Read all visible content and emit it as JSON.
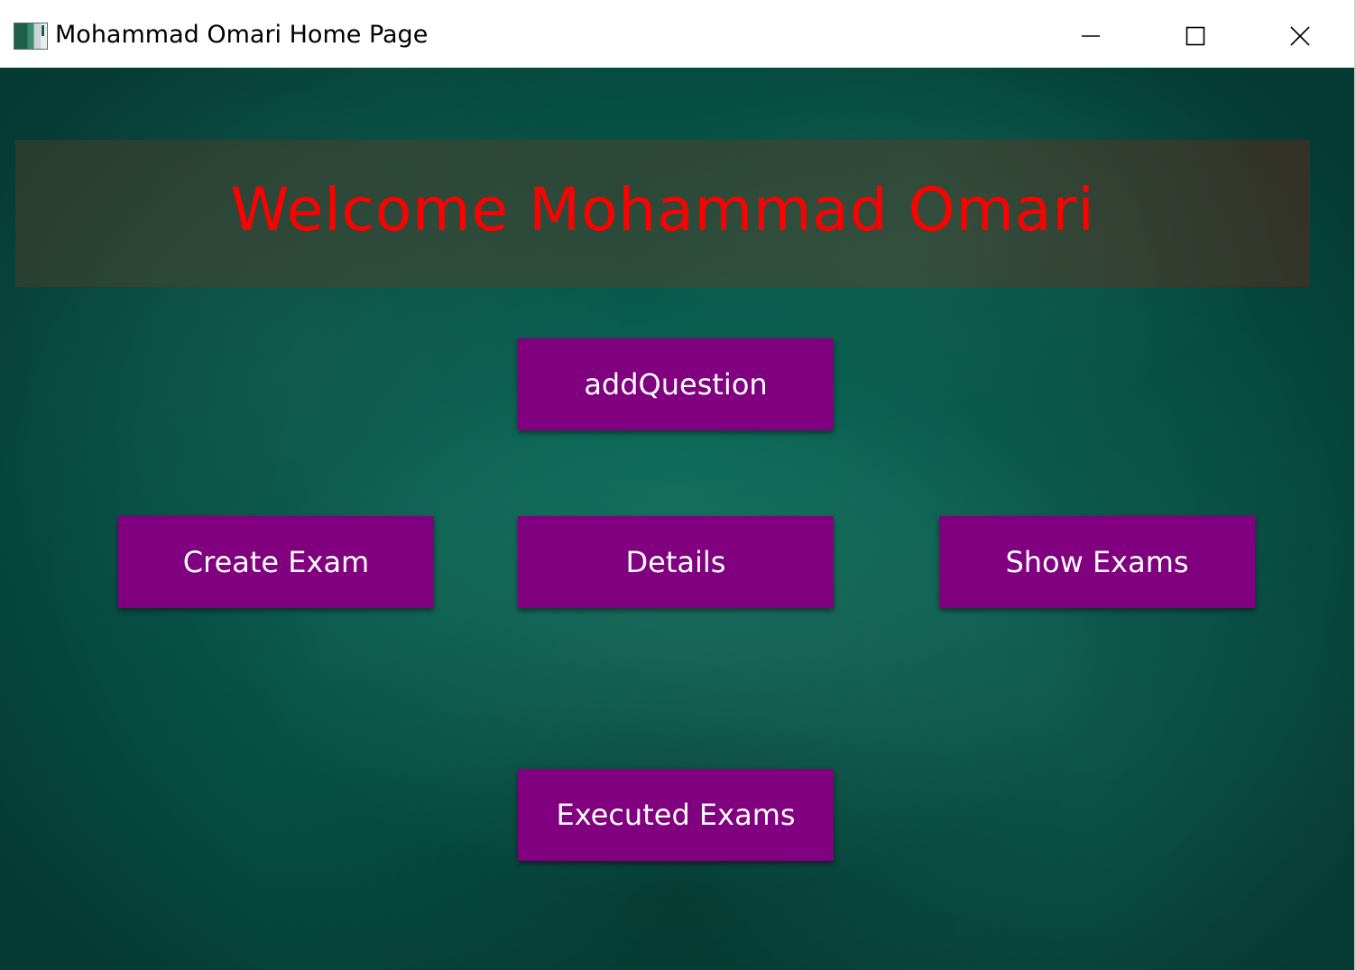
{
  "window": {
    "title": "Mohammad Omari Home Page",
    "icon": "app-window-icon",
    "controls": {
      "minimize_icon": "minimize-icon",
      "maximize_icon": "maximize-icon",
      "close_icon": "close-icon"
    }
  },
  "banner": {
    "welcome_text": "Welcome Mohammad Omari",
    "text_color": "#ff0000"
  },
  "buttons": {
    "add_question": "addQuestion",
    "create_exam": "Create Exam",
    "details": "Details",
    "show_exams": "Show Exams",
    "executed_exams": "Executed Exams"
  },
  "colors": {
    "button_background": "#800080",
    "button_text": "#ffffff",
    "background": "#0a6a58"
  }
}
